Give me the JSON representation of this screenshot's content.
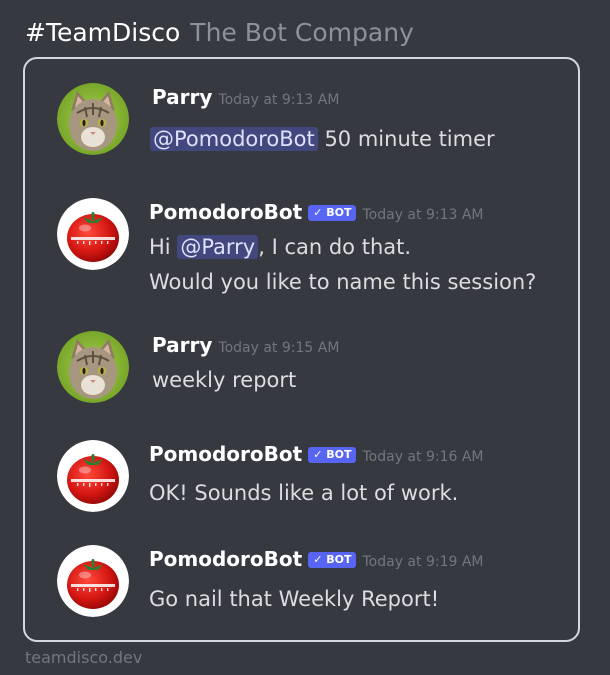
{
  "header": {
    "channel": "#TeamDisco",
    "company": "The Bot Company"
  },
  "messages": [
    {
      "author": "Parry",
      "time": "Today at 9:13 AM",
      "mention": "@PomodoroBot",
      "text": " 50 minute timer"
    },
    {
      "author": "PomodoroBot",
      "badge": "✓ BOT",
      "time": "Today at 9:13 AM",
      "pre": "Hi ",
      "mention": "@Parry",
      "post": ", I can do that.",
      "line2": "Would you like to name this session?"
    },
    {
      "author": "Parry",
      "time": "Today at 9:15 AM",
      "text": "weekly report"
    },
    {
      "author": "PomodoroBot",
      "badge": "✓ BOT",
      "time": "Today at 9:16 AM",
      "text": "OK! Sounds like a lot of work."
    },
    {
      "author": "PomodoroBot",
      "badge": "✓ BOT",
      "time": "Today at 9:19 AM",
      "text": "Go nail that Weekly Report!"
    }
  ],
  "footer": {
    "site": "teamdisco.dev"
  },
  "colors": {
    "background": "#36393f",
    "panel_border": "#d4d7dc",
    "bot_badge": "#5865f2",
    "timestamp": "#72767d"
  }
}
